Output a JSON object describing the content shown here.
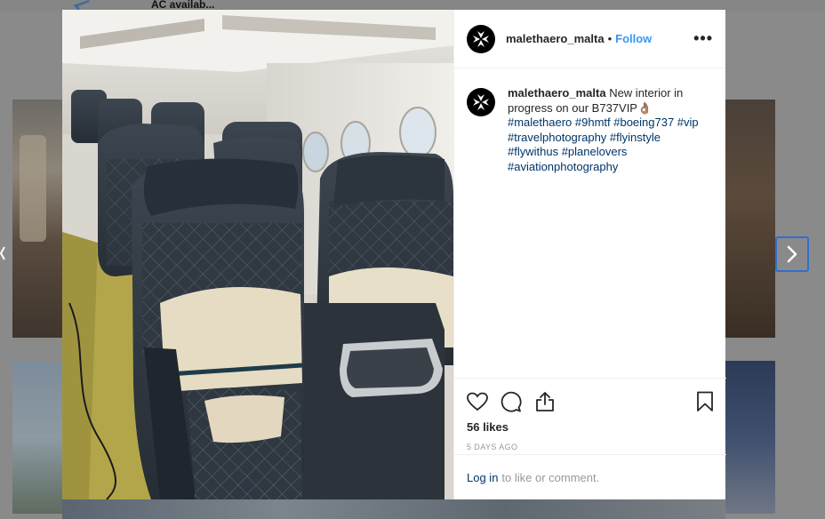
{
  "background": {
    "top_text": "AC availab..."
  },
  "post": {
    "username": "malethaero_malta",
    "follow_label": "Follow",
    "separator": "•",
    "more_label": "•••",
    "caption_username": "malethaero_malta",
    "caption_text": "New interior in progress on our B737VIP",
    "caption_emoji": "👌🏽",
    "hashtags": "#malethaero #9hmtf #boeing737 #vip #travelphotography #flyinstyle #flywithus #planelovers #aviationphotography",
    "likes": "56 likes",
    "timestamp": "5 DAYS AGO",
    "login_label": "Log in",
    "comment_prompt": "to like or comment."
  },
  "icons": {
    "like": "heart-icon",
    "comment": "comment-icon",
    "share": "share-icon",
    "save": "bookmark-icon",
    "next": "chevron-right-icon",
    "logo": "maltese-cross-icon"
  },
  "colors": {
    "link": "#3897f0",
    "hashtag": "#003569",
    "text": "#262626",
    "muted": "#999999",
    "nav_border": "#2f6fd0"
  }
}
